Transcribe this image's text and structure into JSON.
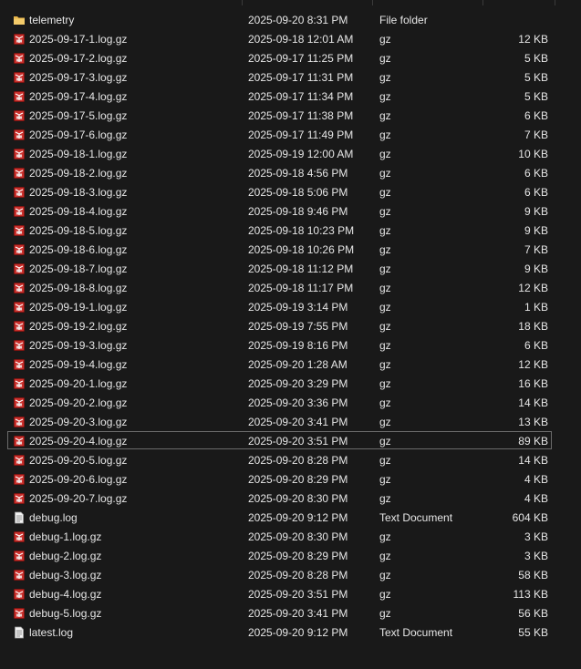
{
  "files": [
    {
      "name": "telemetry",
      "date": "2025-09-20 8:31 PM",
      "type": "File folder",
      "size": "",
      "icon": "folder-icon"
    },
    {
      "name": "2025-09-17-1.log.gz",
      "date": "2025-09-18 12:01 AM",
      "type": "gz",
      "size": "12 KB",
      "icon": "archive-icon"
    },
    {
      "name": "2025-09-17-2.log.gz",
      "date": "2025-09-17 11:25 PM",
      "type": "gz",
      "size": "5 KB",
      "icon": "archive-icon"
    },
    {
      "name": "2025-09-17-3.log.gz",
      "date": "2025-09-17 11:31 PM",
      "type": "gz",
      "size": "5 KB",
      "icon": "archive-icon"
    },
    {
      "name": "2025-09-17-4.log.gz",
      "date": "2025-09-17 11:34 PM",
      "type": "gz",
      "size": "5 KB",
      "icon": "archive-icon"
    },
    {
      "name": "2025-09-17-5.log.gz",
      "date": "2025-09-17 11:38 PM",
      "type": "gz",
      "size": "6 KB",
      "icon": "archive-icon"
    },
    {
      "name": "2025-09-17-6.log.gz",
      "date": "2025-09-17 11:49 PM",
      "type": "gz",
      "size": "7 KB",
      "icon": "archive-icon"
    },
    {
      "name": "2025-09-18-1.log.gz",
      "date": "2025-09-19 12:00 AM",
      "type": "gz",
      "size": "10 KB",
      "icon": "archive-icon"
    },
    {
      "name": "2025-09-18-2.log.gz",
      "date": "2025-09-18 4:56 PM",
      "type": "gz",
      "size": "6 KB",
      "icon": "archive-icon"
    },
    {
      "name": "2025-09-18-3.log.gz",
      "date": "2025-09-18 5:06 PM",
      "type": "gz",
      "size": "6 KB",
      "icon": "archive-icon"
    },
    {
      "name": "2025-09-18-4.log.gz",
      "date": "2025-09-18 9:46 PM",
      "type": "gz",
      "size": "9 KB",
      "icon": "archive-icon"
    },
    {
      "name": "2025-09-18-5.log.gz",
      "date": "2025-09-18 10:23 PM",
      "type": "gz",
      "size": "9 KB",
      "icon": "archive-icon"
    },
    {
      "name": "2025-09-18-6.log.gz",
      "date": "2025-09-18 10:26 PM",
      "type": "gz",
      "size": "7 KB",
      "icon": "archive-icon"
    },
    {
      "name": "2025-09-18-7.log.gz",
      "date": "2025-09-18 11:12 PM",
      "type": "gz",
      "size": "9 KB",
      "icon": "archive-icon"
    },
    {
      "name": "2025-09-18-8.log.gz",
      "date": "2025-09-18 11:17 PM",
      "type": "gz",
      "size": "12 KB",
      "icon": "archive-icon"
    },
    {
      "name": "2025-09-19-1.log.gz",
      "date": "2025-09-19 3:14 PM",
      "type": "gz",
      "size": "1 KB",
      "icon": "archive-icon"
    },
    {
      "name": "2025-09-19-2.log.gz",
      "date": "2025-09-19 7:55 PM",
      "type": "gz",
      "size": "18 KB",
      "icon": "archive-icon"
    },
    {
      "name": "2025-09-19-3.log.gz",
      "date": "2025-09-19 8:16 PM",
      "type": "gz",
      "size": "6 KB",
      "icon": "archive-icon"
    },
    {
      "name": "2025-09-19-4.log.gz",
      "date": "2025-09-20 1:28 AM",
      "type": "gz",
      "size": "12 KB",
      "icon": "archive-icon"
    },
    {
      "name": "2025-09-20-1.log.gz",
      "date": "2025-09-20 3:29 PM",
      "type": "gz",
      "size": "16 KB",
      "icon": "archive-icon"
    },
    {
      "name": "2025-09-20-2.log.gz",
      "date": "2025-09-20 3:36 PM",
      "type": "gz",
      "size": "14 KB",
      "icon": "archive-icon"
    },
    {
      "name": "2025-09-20-3.log.gz",
      "date": "2025-09-20 3:41 PM",
      "type": "gz",
      "size": "13 KB",
      "icon": "archive-icon"
    },
    {
      "name": "2025-09-20-4.log.gz",
      "date": "2025-09-20 3:51 PM",
      "type": "gz",
      "size": "89 KB",
      "icon": "archive-icon",
      "focused": true
    },
    {
      "name": "2025-09-20-5.log.gz",
      "date": "2025-09-20 8:28 PM",
      "type": "gz",
      "size": "14 KB",
      "icon": "archive-icon"
    },
    {
      "name": "2025-09-20-6.log.gz",
      "date": "2025-09-20 8:29 PM",
      "type": "gz",
      "size": "4 KB",
      "icon": "archive-icon"
    },
    {
      "name": "2025-09-20-7.log.gz",
      "date": "2025-09-20 8:30 PM",
      "type": "gz",
      "size": "4 KB",
      "icon": "archive-icon"
    },
    {
      "name": "debug.log",
      "date": "2025-09-20 9:12 PM",
      "type": "Text Document",
      "size": "604 KB",
      "icon": "text-document-icon"
    },
    {
      "name": "debug-1.log.gz",
      "date": "2025-09-20 8:30 PM",
      "type": "gz",
      "size": "3 KB",
      "icon": "archive-icon"
    },
    {
      "name": "debug-2.log.gz",
      "date": "2025-09-20 8:29 PM",
      "type": "gz",
      "size": "3 KB",
      "icon": "archive-icon"
    },
    {
      "name": "debug-3.log.gz",
      "date": "2025-09-20 8:28 PM",
      "type": "gz",
      "size": "58 KB",
      "icon": "archive-icon"
    },
    {
      "name": "debug-4.log.gz",
      "date": "2025-09-20 3:51 PM",
      "type": "gz",
      "size": "113 KB",
      "icon": "archive-icon"
    },
    {
      "name": "debug-5.log.gz",
      "date": "2025-09-20 3:41 PM",
      "type": "gz",
      "size": "56 KB",
      "icon": "archive-icon"
    },
    {
      "name": "latest.log",
      "date": "2025-09-20 9:12 PM",
      "type": "Text Document",
      "size": "55 KB",
      "icon": "text-document-icon"
    }
  ],
  "colors": {
    "background": "#191919",
    "text": "#e6e6e6",
    "folder": "#e8b54a",
    "archive": "#c9302c",
    "focus_border": "#6b6b6b"
  }
}
